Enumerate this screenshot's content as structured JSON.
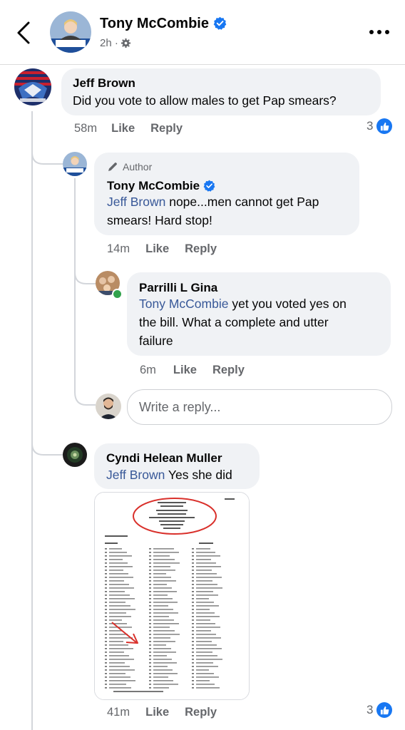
{
  "header": {
    "name": "Tony McCombie",
    "meta": "2h ·",
    "icons": {
      "back": "chevron-left-icon",
      "more": "more-dots-icon",
      "verified": "verified-badge-icon",
      "privacy": "gear-icon"
    }
  },
  "comments": {
    "jeff": {
      "name": "Jeff Brown",
      "text": "Did you vote to allow males to get Pap smears?",
      "time": "58m",
      "like": "Like",
      "reply": "Reply",
      "reactions": "3"
    },
    "tony": {
      "badge": "Author",
      "name": "Tony McCombie",
      "mention": "Jeff Brown",
      "text_line1": " nope...men cannot get Pap",
      "text_line2": "smears!  Hard stop!",
      "time": "14m",
      "like": "Like",
      "reply": "Reply"
    },
    "gina": {
      "name": "Parrilli L Gina",
      "mention": "Tony McCombie",
      "text_line1": "  yet you voted yes on",
      "text_line2": "the bill.   What a complete and utter",
      "text_line3": "failure",
      "time": "6m",
      "like": "Like",
      "reply": "Reply"
    },
    "reply_box": {
      "placeholder": "Write a reply..."
    },
    "cyndi": {
      "name": "Cyndi Helean Muller",
      "mention": "Jeff Brown",
      "text": " Yes she did",
      "time": "41m",
      "like": "Like",
      "reply": "Reply",
      "reactions": "3"
    }
  },
  "colors": {
    "link": "#385898",
    "accent": "#1877f2",
    "bubble": "#f0f2f5",
    "muted": "#65676b",
    "annotation": "#d9302b"
  }
}
